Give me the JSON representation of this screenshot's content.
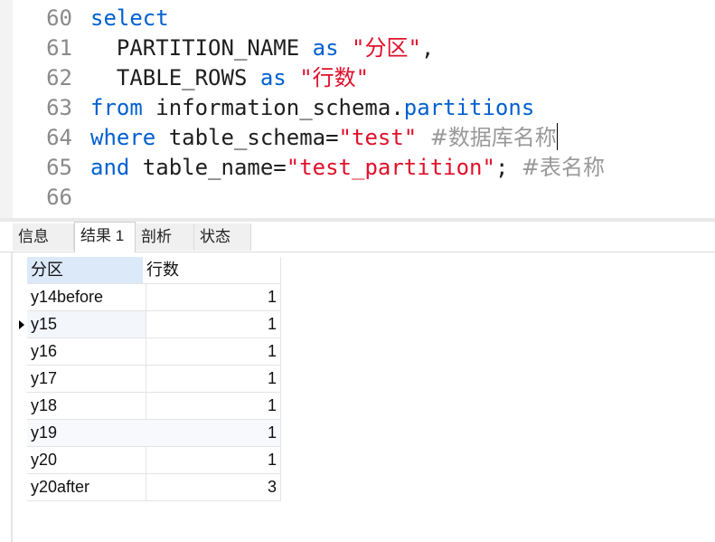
{
  "editor": {
    "lines": [
      {
        "n": "60",
        "parts": [
          {
            "t": "select",
            "c": "kw"
          }
        ]
      },
      {
        "n": "61",
        "parts": [
          {
            "t": "  PARTITION_NAME ",
            "c": ""
          },
          {
            "t": "as",
            "c": "kw"
          },
          {
            "t": " ",
            "c": ""
          },
          {
            "t": "\"分区\"",
            "c": "str"
          },
          {
            "t": ",",
            "c": ""
          }
        ]
      },
      {
        "n": "62",
        "parts": [
          {
            "t": "  TABLE_ROWS ",
            "c": ""
          },
          {
            "t": "as",
            "c": "kw"
          },
          {
            "t": " ",
            "c": ""
          },
          {
            "t": "\"行数\"",
            "c": "str"
          }
        ]
      },
      {
        "n": "63",
        "parts": [
          {
            "t": "from",
            "c": "kw"
          },
          {
            "t": " information_schema.",
            "c": ""
          },
          {
            "t": "partitions",
            "c": "kw"
          }
        ]
      },
      {
        "n": "64",
        "parts": [
          {
            "t": "where",
            "c": "kw"
          },
          {
            "t": " table_schema=",
            "c": ""
          },
          {
            "t": "\"test\"",
            "c": "str"
          },
          {
            "t": " ",
            "c": ""
          },
          {
            "t": "#数据库名称",
            "c": "cm"
          }
        ]
      },
      {
        "n": "65",
        "parts": [
          {
            "t": "and",
            "c": "kw"
          },
          {
            "t": " table_name=",
            "c": ""
          },
          {
            "t": "\"test_partition\"",
            "c": "str"
          },
          {
            "t": "; ",
            "c": ""
          },
          {
            "t": "#表名称",
            "c": "cm"
          }
        ]
      },
      {
        "n": "66",
        "parts": []
      }
    ]
  },
  "tabs": [
    {
      "label": "信息",
      "active": false
    },
    {
      "label": "结果 1",
      "active": true
    },
    {
      "label": "剖析",
      "active": false
    },
    {
      "label": "状态",
      "active": false
    }
  ],
  "results": {
    "columns": [
      "分区",
      "行数"
    ],
    "rows": [
      {
        "partition": "y14before",
        "rows": "1"
      },
      {
        "partition": "y15",
        "rows": "1"
      },
      {
        "partition": "y16",
        "rows": "1"
      },
      {
        "partition": "y17",
        "rows": "1"
      },
      {
        "partition": "y18",
        "rows": "1"
      },
      {
        "partition": "y19",
        "rows": "1"
      },
      {
        "partition": "y20",
        "rows": "1"
      },
      {
        "partition": "y20after",
        "rows": "3"
      }
    ],
    "current_row_index": 1
  }
}
